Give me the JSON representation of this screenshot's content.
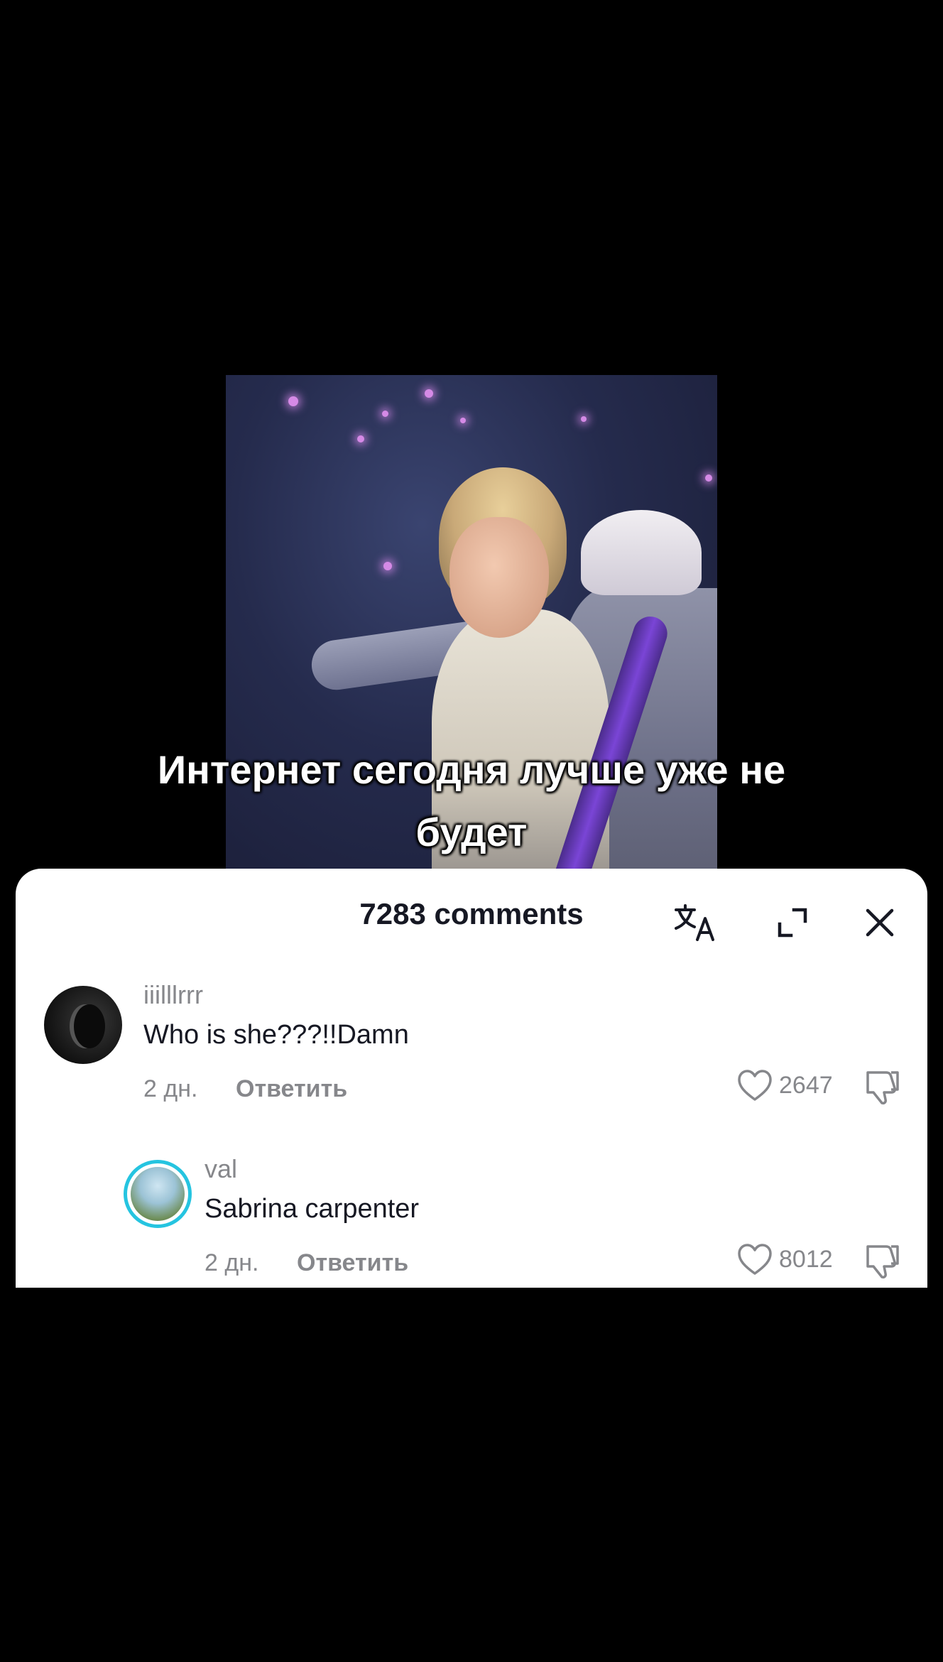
{
  "video": {
    "caption_line1": "Интернет сегодня лучше уже не",
    "caption_line2": "будет"
  },
  "comments_sheet": {
    "title": "7283 comments",
    "icons": {
      "translate": "translate-icon",
      "expand": "expand-icon",
      "close": "close-icon"
    },
    "comments": [
      {
        "username": "iiilllrrr",
        "text": "Who is she???!!Damn",
        "time": "2 дн.",
        "reply_label": "Ответить",
        "likes": "2647"
      },
      {
        "username": "val",
        "text": "Sabrina carpenter",
        "time": "2 дн.",
        "reply_label": "Ответить",
        "likes": "8012"
      }
    ]
  },
  "colors": {
    "background": "#000000",
    "sheet": "#ffffff",
    "primary_text": "#161823",
    "secondary_text": "#86878b",
    "avatar_ring": "#25c4e0"
  }
}
